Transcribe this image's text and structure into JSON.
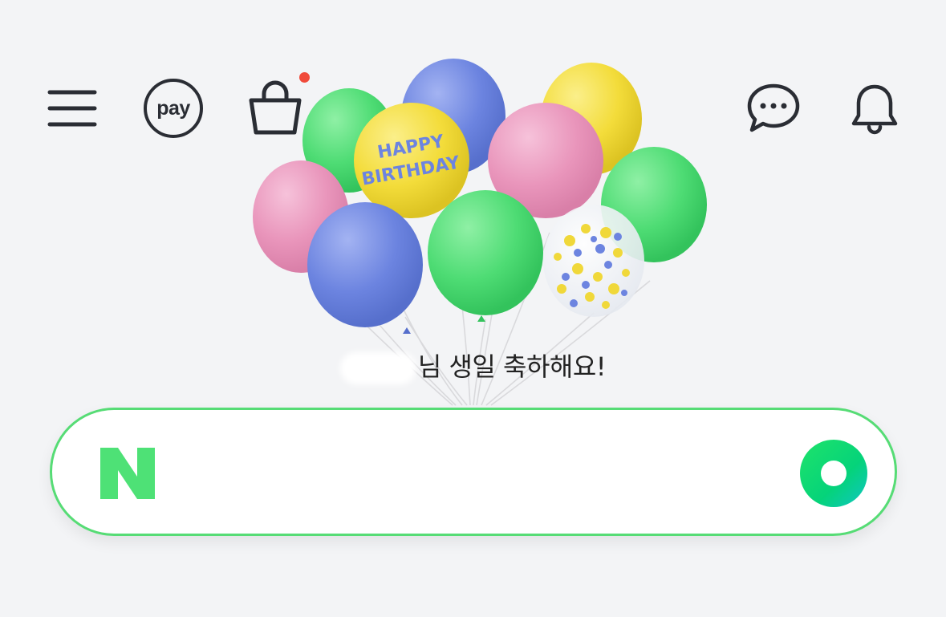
{
  "header": {
    "menu_icon": "hamburger-menu-icon",
    "pay_label": "pay",
    "cart_icon": "shopping-bag-icon",
    "cart_badge_color": "#f04a3a",
    "talk_icon": "chat-bubble-icon",
    "bell_icon": "bell-icon",
    "icon_color": "#2a2d34"
  },
  "birthday": {
    "balloon_text_line1": "HAPPY",
    "balloon_text_line2": "BIRTHDAY",
    "message": "님 생일 축하해요!",
    "balloon_colors": [
      "#58de7d",
      "#6f86e0",
      "#f5de3f",
      "#ea97bd"
    ]
  },
  "search": {
    "logo_text": "N",
    "placeholder": "",
    "brand_color": "#4ee176",
    "greendot_icon": "greendot-icon"
  }
}
